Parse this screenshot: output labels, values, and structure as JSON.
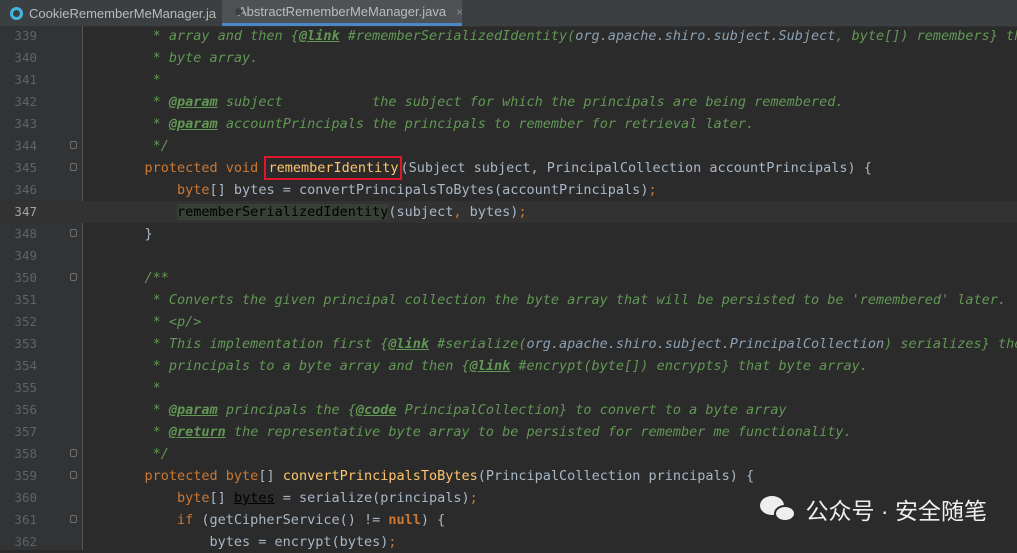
{
  "tabs": [
    {
      "label": "CookieRememberMeManager.ja",
      "active": false,
      "icon": "java-class-icon"
    },
    {
      "label": "AbstractRememberMeManager.java",
      "active": true,
      "icon": "java-class-icon",
      "close": "×"
    }
  ],
  "lines": [
    {
      "num": "339",
      "fold": false,
      "tokens": [
        [
          "c",
          "     * array and then {"
        ],
        [
          "tag",
          "@link"
        ],
        [
          "c",
          " #rememberSerializedIdentity("
        ],
        [
          "ref",
          "org.apache.shiro.subject.Subject"
        ],
        [
          "c",
          ", byte[]) remembers} that"
        ]
      ]
    },
    {
      "num": "340",
      "fold": false,
      "tokens": [
        [
          "c",
          "     * byte array."
        ]
      ]
    },
    {
      "num": "341",
      "fold": false,
      "tokens": [
        [
          "c",
          "     *"
        ]
      ]
    },
    {
      "num": "342",
      "fold": false,
      "tokens": [
        [
          "c",
          "     * "
        ],
        [
          "tag",
          "@param"
        ],
        [
          "c",
          " subject           the subject for which the principals are being remembered."
        ]
      ]
    },
    {
      "num": "343",
      "fold": false,
      "tokens": [
        [
          "c",
          "     * "
        ],
        [
          "tag",
          "@param"
        ],
        [
          "c",
          " accountPrincipals the principals to remember for retrieval later."
        ]
      ]
    },
    {
      "num": "344",
      "fold": true,
      "tokens": [
        [
          "c",
          "     */"
        ]
      ]
    },
    {
      "num": "345",
      "fold": true,
      "tokens": [
        [
          "kw",
          "    protected void "
        ],
        [
          "fnbox",
          "rememberIdentity"
        ],
        [
          "tx",
          "(Subject subject, PrincipalCollection accountPrincipals) {"
        ]
      ]
    },
    {
      "num": "346",
      "fold": false,
      "tokens": [
        [
          "kw",
          "        byte"
        ],
        [
          "tx",
          "[] bytes = convertPrincipalsToBytes(accountPrincipals)"
        ],
        [
          "kw",
          ";"
        ]
      ]
    },
    {
      "num": "347",
      "fold": false,
      "current": true,
      "tokens": [
        [
          "tx",
          "        "
        ],
        [
          "hl",
          "rememberSerializedIdentity"
        ],
        [
          "tx",
          "(subject"
        ],
        [
          "kw",
          ", "
        ],
        [
          "tx",
          "bytes)"
        ],
        [
          "kw",
          ";"
        ]
      ]
    },
    {
      "num": "348",
      "fold": true,
      "tokens": [
        [
          "tx",
          "    }"
        ]
      ]
    },
    {
      "num": "349",
      "fold": false,
      "tokens": []
    },
    {
      "num": "350",
      "fold": true,
      "tokens": [
        [
          "c",
          "    /**"
        ]
      ]
    },
    {
      "num": "351",
      "fold": false,
      "tokens": [
        [
          "c",
          "     * Converts the given principal collection the byte array that will be persisted to be 'remembered' later."
        ]
      ]
    },
    {
      "num": "352",
      "fold": false,
      "tokens": [
        [
          "c",
          "     * <p/>"
        ]
      ]
    },
    {
      "num": "353",
      "fold": false,
      "tokens": [
        [
          "c",
          "     * This implementation first {"
        ],
        [
          "tag",
          "@link"
        ],
        [
          "c",
          " #serialize("
        ],
        [
          "ref",
          "org.apache.shiro.subject.PrincipalCollection"
        ],
        [
          "c",
          ") serializes} the"
        ]
      ]
    },
    {
      "num": "354",
      "fold": false,
      "tokens": [
        [
          "c",
          "     * principals to a byte array and then {"
        ],
        [
          "tag",
          "@link"
        ],
        [
          "c",
          " #encrypt(byte[]) encrypts} that byte array."
        ]
      ]
    },
    {
      "num": "355",
      "fold": false,
      "tokens": [
        [
          "c",
          "     *"
        ]
      ]
    },
    {
      "num": "356",
      "fold": false,
      "tokens": [
        [
          "c",
          "     * "
        ],
        [
          "tag",
          "@param"
        ],
        [
          "c",
          " principals the {"
        ],
        [
          "tag",
          "@code"
        ],
        [
          "c",
          " PrincipalCollection} to convert to a byte array"
        ]
      ]
    },
    {
      "num": "357",
      "fold": false,
      "tokens": [
        [
          "c",
          "     * "
        ],
        [
          "tag",
          "@return"
        ],
        [
          "c",
          " the representative byte array to be persisted for remember me functionality."
        ]
      ]
    },
    {
      "num": "358",
      "fold": true,
      "tokens": [
        [
          "c",
          "     */"
        ]
      ]
    },
    {
      "num": "359",
      "fold": true,
      "tokens": [
        [
          "kw",
          "    protected byte"
        ],
        [
          "tx",
          "[] "
        ],
        [
          "fn",
          "convertPrincipalsToBytes"
        ],
        [
          "tx",
          "(PrincipalCollection principals) {"
        ]
      ]
    },
    {
      "num": "360",
      "fold": false,
      "tokens": [
        [
          "kw",
          "        byte"
        ],
        [
          "tx",
          "[] "
        ],
        [
          "ul",
          "bytes"
        ],
        [
          "tx",
          " = serialize(principals)"
        ],
        [
          "kw",
          ";"
        ]
      ]
    },
    {
      "num": "361",
      "fold": true,
      "tokens": [
        [
          "kw",
          "        if "
        ],
        [
          "tx",
          "(getCipherService() != "
        ],
        [
          "nu",
          "null"
        ],
        [
          "tx",
          ") {"
        ]
      ]
    },
    {
      "num": "362",
      "fold": false,
      "tokens": [
        [
          "tx",
          "            bytes = encrypt(bytes)"
        ],
        [
          "kw",
          ";"
        ]
      ]
    }
  ],
  "watermark": {
    "text": "公众号 · 安全随笔",
    "icon": "wechat-icon"
  },
  "colors": {
    "highlight_box": "#e0162b",
    "comment": "#629755",
    "keyword": "#cc7832",
    "method": "#ffc66d"
  }
}
